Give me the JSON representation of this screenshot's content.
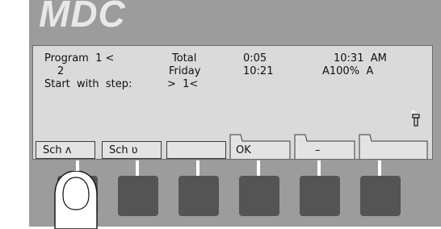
{
  "brand": {
    "name": "MDC"
  },
  "display": {
    "program_label": "Program  1 <",
    "program_value": "2",
    "total_label": "Total",
    "day": "Friday",
    "duration": "0:05",
    "time_secondary": "10:21",
    "clock": "10:31  AM",
    "status": "A100%  A",
    "start_step_label": "Start  with  step:",
    "start_step_value": ">  1<"
  },
  "softkeys": {
    "key1": "Sch ʌ",
    "key2": "Sch ʋ",
    "key3": "",
    "key4": "OK",
    "key5": "–",
    "key6": ""
  },
  "icons": {
    "probe": "probe-icon",
    "finger": "pointing-finger"
  },
  "colors": {
    "panel": "#9c9c9c",
    "lcd": "#dadada",
    "button": "#545454"
  }
}
